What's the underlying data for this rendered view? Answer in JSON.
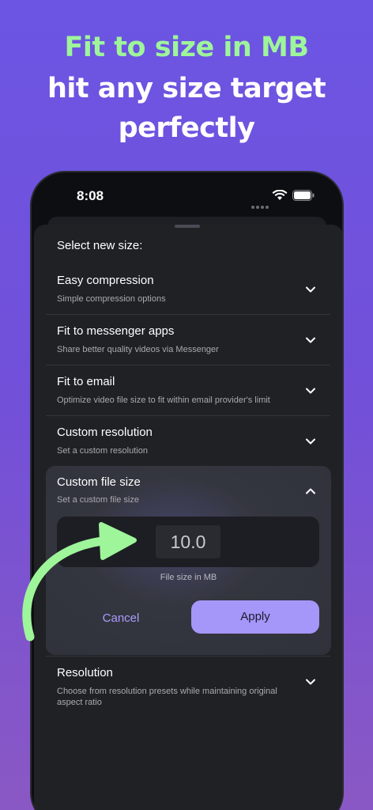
{
  "headline": {
    "line1": "Fit to size in MB",
    "line2": "hit any size target",
    "line3": "perfectly"
  },
  "status_bar": {
    "time": "8:08"
  },
  "sheet": {
    "title": "Select new size:",
    "options": [
      {
        "title": "Easy compression",
        "subtitle": "Simple compression options"
      },
      {
        "title": "Fit to messenger apps",
        "subtitle": "Share better quality videos via Messenger"
      },
      {
        "title": "Fit to email",
        "subtitle": "Optimize video file size to fit within email provider's limit"
      },
      {
        "title": "Custom resolution",
        "subtitle": "Set a custom resolution"
      }
    ],
    "expanded": {
      "title": "Custom file size",
      "subtitle": "Set a custom file size",
      "value": "10.0",
      "unit_label": "File size in MB",
      "cancel_label": "Cancel",
      "apply_label": "Apply"
    },
    "last_option": {
      "title": "Resolution",
      "subtitle": "Choose from resolution presets while maintaining original aspect ratio"
    }
  },
  "colors": {
    "accent": "#a596fa",
    "headline_green": "#9ef59a",
    "background": "#6c55e3"
  }
}
